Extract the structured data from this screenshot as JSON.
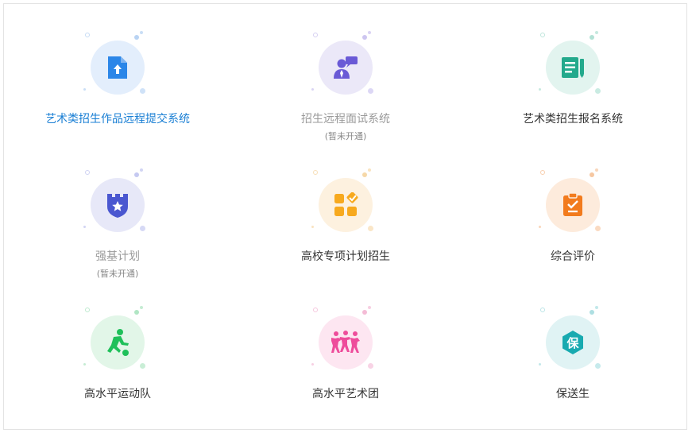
{
  "systems": [
    {
      "label": "艺术类招生作品远程提交系统",
      "note": "",
      "icon": "upload-file-icon",
      "accent": "#2b86e8",
      "bg": "#e3eefc",
      "state": "active"
    },
    {
      "label": "招生远程面试系统",
      "note": "(暂未开通)",
      "icon": "interviewer-icon",
      "accent": "#6a5ad6",
      "bg": "#ebe8f8",
      "state": "disabled"
    },
    {
      "label": "艺术类招生报名系统",
      "note": "",
      "icon": "registration-form-icon",
      "accent": "#23a98c",
      "bg": "#e2f4ef",
      "state": "normal"
    },
    {
      "label": "强基计划",
      "note": "(暂未开通)",
      "icon": "castle-shield-icon",
      "accent": "#4a57d0",
      "bg": "#e7e8f8",
      "state": "disabled"
    },
    {
      "label": "高校专项计划招生",
      "note": "",
      "icon": "app-grid-check-icon",
      "accent": "#f7a91e",
      "bg": "#fdf1df",
      "state": "normal"
    },
    {
      "label": "综合评价",
      "note": "",
      "icon": "clipboard-check-icon",
      "accent": "#f27b1d",
      "bg": "#fdebdc",
      "state": "normal"
    },
    {
      "label": "高水平运动队",
      "note": "",
      "icon": "soccer-player-icon",
      "accent": "#1fc05a",
      "bg": "#e2f6e8",
      "state": "normal"
    },
    {
      "label": "高水平艺术团",
      "note": "",
      "icon": "dancers-icon",
      "accent": "#ee4c9b",
      "bg": "#fde6f1",
      "state": "normal"
    },
    {
      "label": "保送生",
      "note": "",
      "icon": "recommend-badge-icon",
      "accent": "#18aab0",
      "bg": "#e0f3f4",
      "state": "normal"
    }
  ],
  "badge_text": "保"
}
